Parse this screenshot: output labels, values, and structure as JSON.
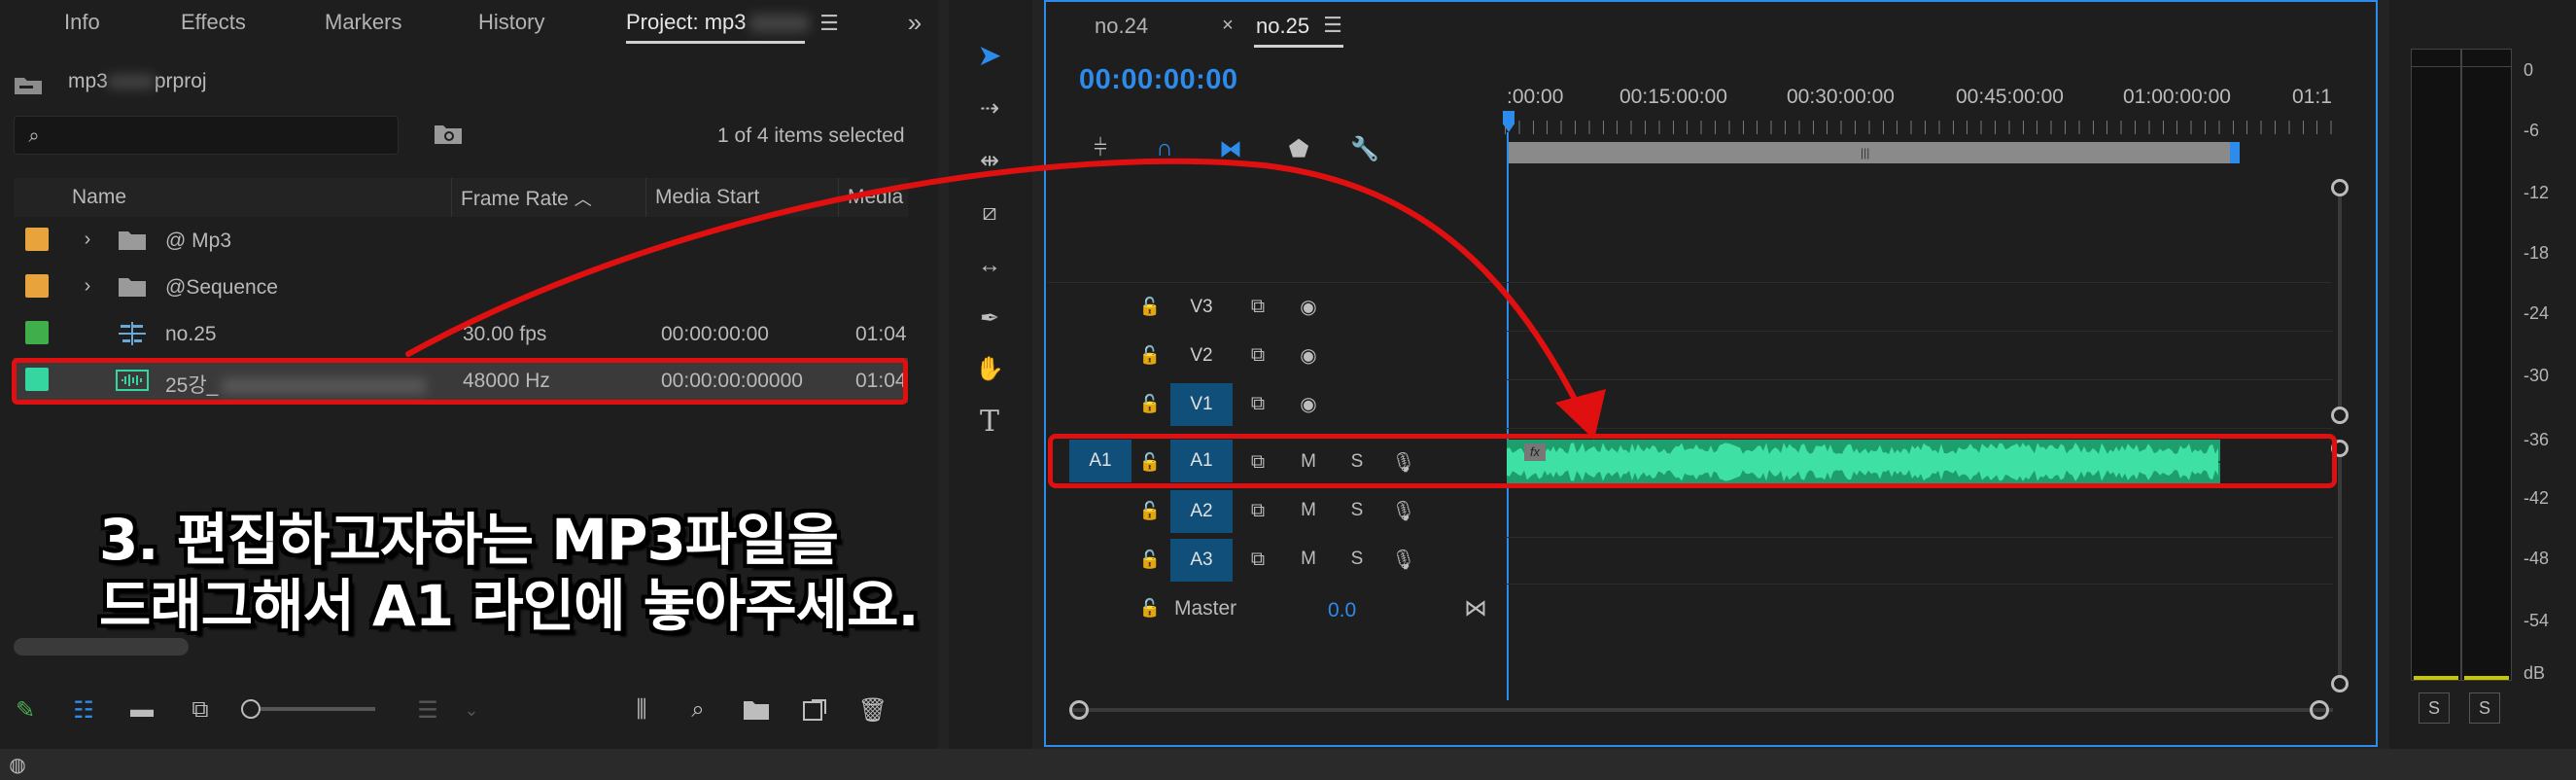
{
  "project_panel": {
    "tabs": [
      "Info",
      "Effects",
      "Markers",
      "History"
    ],
    "active_tab": "Project: mp3",
    "project_file_prefix": "mp3",
    "project_file_suffix": "prproj",
    "selection_status": "1 of 4 items selected",
    "columns": [
      "Name",
      "Frame Rate",
      "Media Start",
      "Media"
    ],
    "items": [
      {
        "name": "@ Mp3",
        "type": "folder",
        "color": "#e8a33c",
        "frame_rate": "",
        "media_start": "",
        "media_end": ""
      },
      {
        "name": "@Sequence",
        "type": "folder",
        "color": "#e8a33c",
        "frame_rate": "",
        "media_start": "",
        "media_end": ""
      },
      {
        "name": "no.25",
        "type": "sequence",
        "color": "#3fae4b",
        "frame_rate": "30.00 fps",
        "media_start": "00:00:00:00",
        "media_end": "01:04"
      },
      {
        "name": "25강_",
        "type": "audio",
        "color": "#35d6a0",
        "frame_rate": "48000 Hz",
        "media_start": "00:00:00:00000",
        "media_end": "01:04"
      }
    ]
  },
  "instruction_overlay": {
    "line1": "3. 편집하고자하는 MP3파일을",
    "line2": "드래그해서 A1 라인에 놓아주세요."
  },
  "timeline": {
    "tabs": [
      "no.24",
      "no.25"
    ],
    "active_tab": "no.25",
    "timecode": "00:00:00:00",
    "ruler_labels": [
      ":00:00",
      "00:15:00:00",
      "00:30:00:00",
      "00:45:00:00",
      "01:00:00:00",
      "01:1"
    ],
    "video_tracks": [
      "V3",
      "V2",
      "V1"
    ],
    "audio_tracks": [
      "A1",
      "A2",
      "A3"
    ],
    "source_patch": "A1",
    "mute_label": "M",
    "solo_label": "S",
    "master_label": "Master",
    "master_value": "0.0",
    "clip_fx_badge": "fx"
  },
  "audio_meter": {
    "scale": [
      "0",
      "-6",
      "-12",
      "-18",
      "-24",
      "-30",
      "-36",
      "-42",
      "-48",
      "-54",
      "dB"
    ],
    "solo_buttons": [
      "S",
      "S"
    ]
  },
  "colors": {
    "accent_blue": "#2d8ceb",
    "annotation_red": "#e01010",
    "clip_green": "#2fc98b",
    "track_on": "#0f4f79"
  }
}
